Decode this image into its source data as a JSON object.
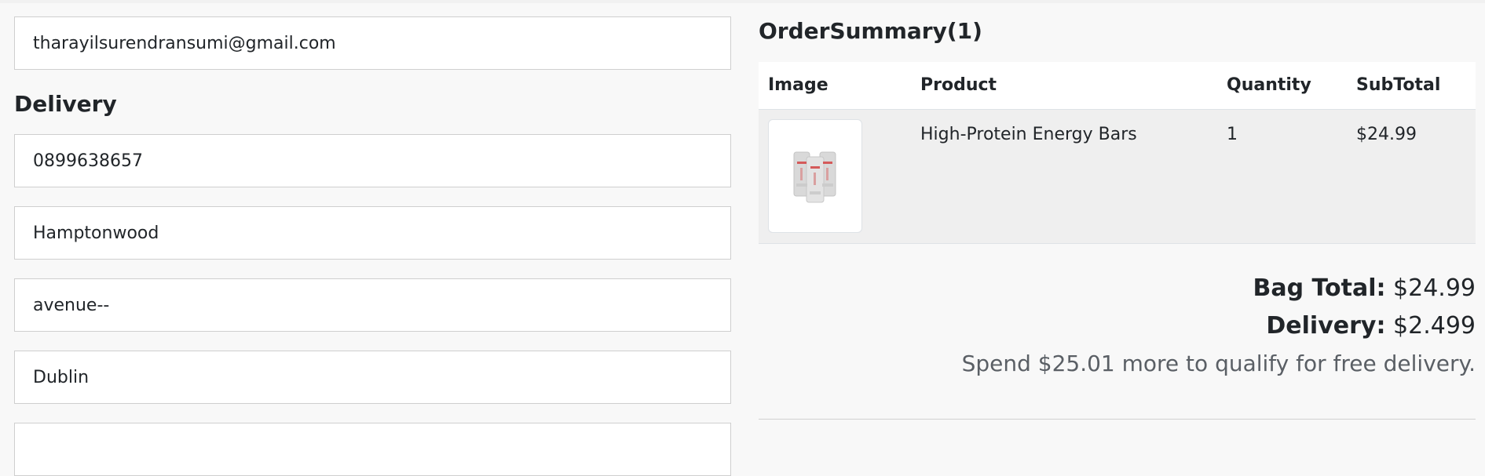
{
  "contact": {
    "email": "tharayilsurendransumi@gmail.com"
  },
  "delivery": {
    "heading": "Delivery",
    "phone": "0899638657",
    "address_line1": "Hamptonwood",
    "address_line2": "avenue--",
    "city": "Dublin",
    "next_field": ""
  },
  "order_summary": {
    "title": "OrderSummary(1)",
    "columns": {
      "image": "Image",
      "product": "Product",
      "quantity": "Quantity",
      "subtotal": "SubTotal"
    },
    "items": [
      {
        "image_icon": "product-thumbnail-icon",
        "product": "High-Protein Energy Bars",
        "quantity": "1",
        "subtotal": "$24.99"
      }
    ],
    "bag_total_label": "Bag Total:",
    "bag_total_value": "$24.99",
    "delivery_label": "Delivery:",
    "delivery_value": "$2.499",
    "free_delivery_message": "Spend $25.01 more to qualify for free delivery."
  }
}
